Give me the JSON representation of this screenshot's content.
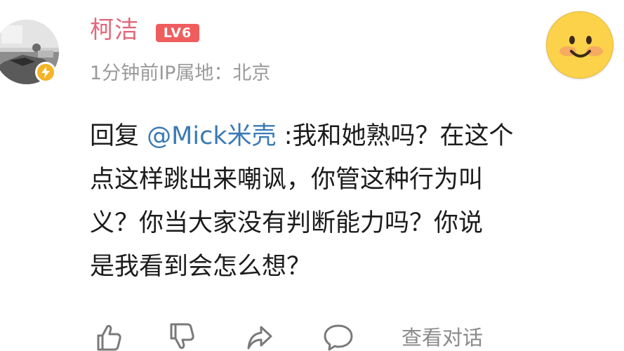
{
  "comment": {
    "user": {
      "name": "柯洁",
      "level_badge": "LV6",
      "avatar_icon": "avatar-photo",
      "verified_icon": "lightning-icon",
      "verified_color": "#f4b425"
    },
    "meta": {
      "time": "1分钟前",
      "ip_location": "IP属地：北京"
    },
    "emoji_icon": "smiley-face-icon",
    "body": {
      "reply_prefix": "回复",
      "mention": "@Mick米壳",
      "lines": [
        ":我和她熟吗？在这个",
        "点这样跳出来嘲讽，你管这种行为叫",
        "义？你当大家没有判断能力吗？你说",
        "是我看到会怎么想？"
      ]
    },
    "actions": {
      "like_icon": "thumbs-up-icon",
      "dislike_icon": "thumbs-down-icon",
      "share_icon": "share-arrow-icon",
      "reply_icon": "comment-bubble-icon",
      "view_dialog": "查看对话"
    }
  },
  "colors": {
    "username": "#e2697b",
    "level_badge": "#ef5d5d",
    "mention": "#3a7ab4",
    "meta": "#9a9a9a",
    "body_text": "#1c1c1c",
    "emoji": "#fbd24a"
  }
}
